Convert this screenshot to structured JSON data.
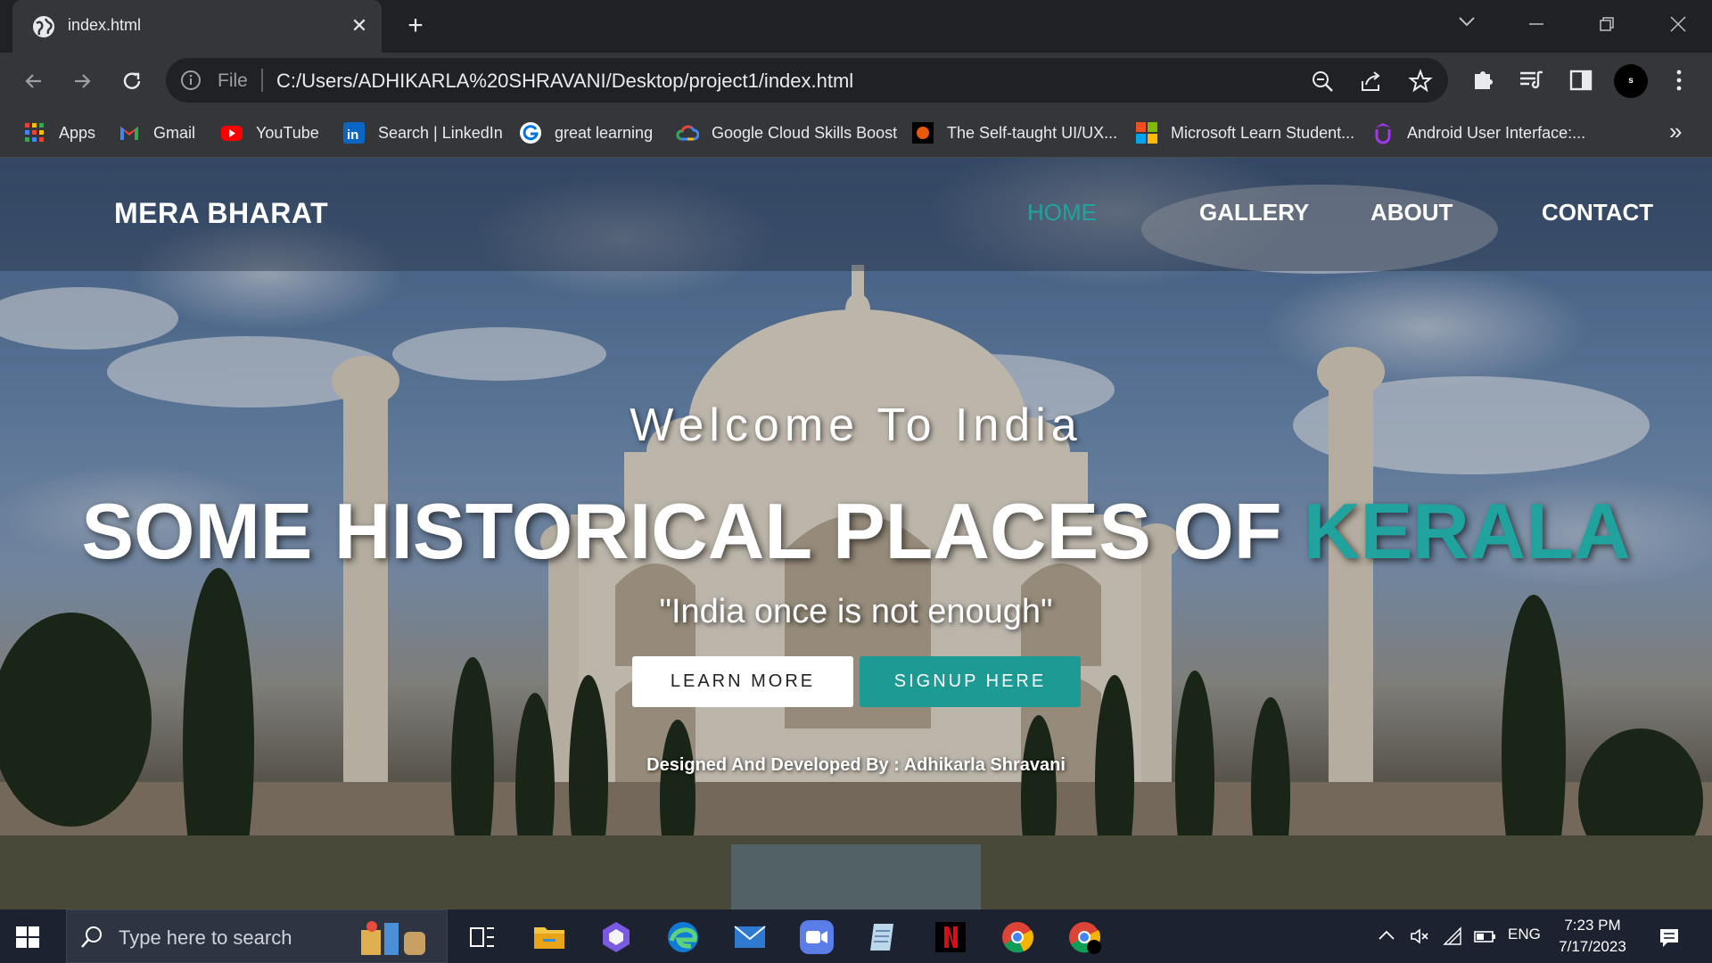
{
  "browser": {
    "tab_title": "index.html",
    "omnibox_scheme_label": "File",
    "url": "C:/Users/ADHIKARLA%20SHRAVANI/Desktop/project1/index.html",
    "profile_initial": "s",
    "bookmarks": [
      {
        "label": "Apps",
        "icon": "apps-grid-icon"
      },
      {
        "label": "Gmail",
        "icon": "gmail-icon"
      },
      {
        "label": "YouTube",
        "icon": "youtube-icon"
      },
      {
        "label": "Search | LinkedIn",
        "icon": "linkedin-icon"
      },
      {
        "label": "great learning",
        "icon": "great-learning-icon"
      },
      {
        "label": "Google Cloud Skills Boost",
        "icon": "google-cloud-icon"
      },
      {
        "label": "The Self-taught UI/UX...",
        "icon": "record-icon"
      },
      {
        "label": "Microsoft Learn Student...",
        "icon": "microsoft-icon"
      },
      {
        "label": "Android User Interface:...",
        "icon": "udemy-icon"
      }
    ]
  },
  "site": {
    "logo": "MERA BHARAT",
    "nav": [
      "HOME",
      "GALLERY",
      "ABOUT",
      "CONTACT"
    ],
    "welcome": "Welcome To India",
    "headline_main": "SOME HISTORICAL PLACES OF ",
    "headline_accent": "KERALA",
    "tagline": "\"India once is not enough\"",
    "btn_learn": "LEARN MORE",
    "btn_signup": "SIGNUP HERE",
    "credit": "Designed And Developed By : Adhikarla Shravani",
    "accent_color": "#20a39e"
  },
  "taskbar": {
    "search_placeholder": "Type here to search",
    "language": "ENG",
    "time": "7:23 PM",
    "date": "7/17/2023"
  }
}
